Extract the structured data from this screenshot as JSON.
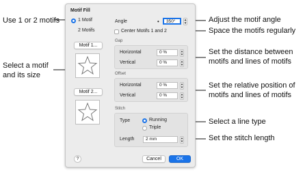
{
  "dialog": {
    "title": "Motif Fill",
    "motif_count": {
      "options": [
        "1 Motif",
        "2 Motifs"
      ],
      "selected": "1 Motif"
    },
    "motif1_button": "Motif 1...",
    "motif2_button": "Motif 2...",
    "angle": {
      "label": "Angle",
      "value": "350°"
    },
    "center_motifs": {
      "label": "Center Motifs 1 and 2",
      "checked": false
    },
    "gap": {
      "title": "Gap",
      "horizontal": {
        "label": "Horizontal",
        "value": "0 %"
      },
      "vertical": {
        "label": "Vertical",
        "value": "0 %"
      }
    },
    "offset": {
      "title": "Offset",
      "horizontal": {
        "label": "Horizontal",
        "value": "0 %"
      },
      "vertical": {
        "label": "Vertical",
        "value": "0 %"
      }
    },
    "stitch": {
      "title": "Stitch",
      "type_label": "Type",
      "type_options": [
        "Running",
        "Triple"
      ],
      "type_selected": "Running",
      "length_label": "Length",
      "length_value": "2 mm"
    },
    "help_label": "?",
    "cancel_label": "Cancel",
    "ok_label": "OK",
    "accent_color": "#1a73e8"
  },
  "annotations": {
    "use_motifs": "Use 1 or 2 motifs",
    "select_motif_line1": "Select a motif",
    "select_motif_line2": "and its size",
    "adjust_angle": "Adjust the motif angle",
    "space_regularly": "Space the motifs regularly",
    "gap_line1": "Set the distance between",
    "gap_line2": "motifs and lines of motifs",
    "offset_line1": "Set the relative position of",
    "offset_line2": "motifs and lines of motifs",
    "line_type": "Select a line type",
    "stitch_length": "Set the stitch length"
  }
}
